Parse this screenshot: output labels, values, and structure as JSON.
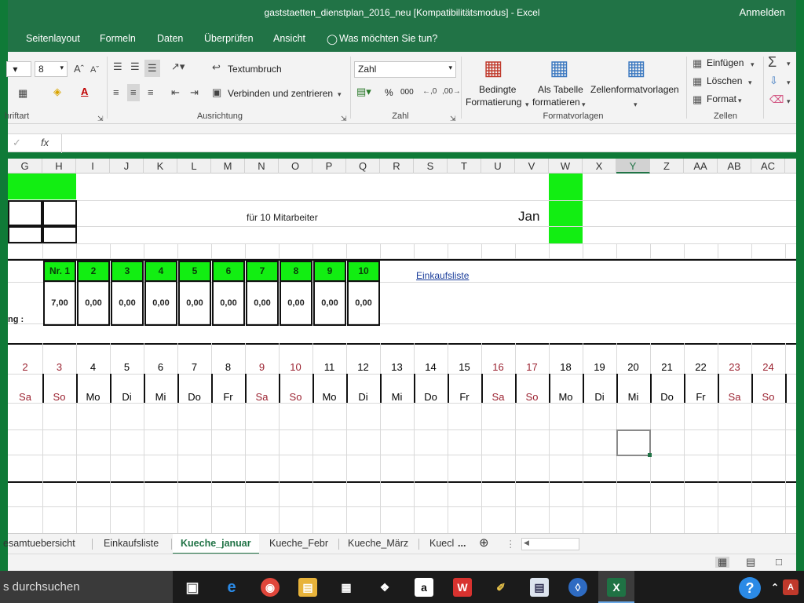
{
  "window": {
    "title": "gaststaetten_dienstplan_2016_neu  [Kompatibilitätsmodus] - Excel",
    "signin": "Anmelden"
  },
  "menu": [
    "Seitenlayout",
    "Formeln",
    "Daten",
    "Überprüfen",
    "Ansicht",
    "Was möchten Sie tun?"
  ],
  "ribbon": {
    "font_size": "8",
    "group_font": "hriftart",
    "wrap_text": "Textumbruch",
    "merge_center": "Verbinden und zentrieren",
    "group_alignment": "Ausrichtung",
    "number_format": "Zahl",
    "percent": "%",
    "thousands": "000",
    "group_number": "Zahl",
    "cond_format_1": "Bedingte",
    "cond_format_2": "Formatierung",
    "as_table_1": "Als Tabelle",
    "as_table_2": "formatieren",
    "cell_styles": "Zellenformatvorlagen",
    "group_styles": "Formatvorlagen",
    "insert": "Einfügen",
    "delete": "Löschen",
    "format": "Format",
    "group_cells": "Zellen"
  },
  "formula_bar": {
    "fx": "fx",
    "value": ""
  },
  "columns": [
    "G",
    "H",
    "I",
    "J",
    "K",
    "L",
    "M",
    "N",
    "O",
    "P",
    "Q",
    "R",
    "S",
    "T",
    "U",
    "V",
    "W",
    "X",
    "Y",
    "Z",
    "AA",
    "AB",
    "AC"
  ],
  "selected_column": "Y",
  "sheet": {
    "subtitle": "für 10 Mitarbeiter",
    "month": "Jan",
    "shopping_link": "Einkaufsliste",
    "row_label": "ng :",
    "employee_headers": [
      "Nr. 1",
      "2",
      "3",
      "4",
      "5",
      "6",
      "7",
      "8",
      "9",
      "10"
    ],
    "employee_values": [
      "7,00",
      "0,00",
      "0,00",
      "0,00",
      "0,00",
      "0,00",
      "0,00",
      "0,00",
      "0,00",
      "0,00"
    ],
    "days": [
      "2",
      "3",
      "4",
      "5",
      "6",
      "7",
      "8",
      "9",
      "10",
      "11",
      "12",
      "13",
      "14",
      "15",
      "16",
      "17",
      "18",
      "19",
      "20",
      "21",
      "22",
      "23",
      "24"
    ],
    "weekdays": [
      "Sa",
      "So",
      "Mo",
      "Di",
      "Mi",
      "Do",
      "Fr",
      "Sa",
      "So",
      "Mo",
      "Di",
      "Mi",
      "Do",
      "Fr",
      "Sa",
      "So",
      "Mo",
      "Di",
      "Mi",
      "Do",
      "Fr",
      "Sa",
      "So"
    ],
    "weekend_color": "#9b2230",
    "highlight_color": "#12ee12"
  },
  "tabs": [
    "esamtuebersicht",
    "Einkaufsliste",
    "Kueche_januar",
    "Kueche_Febr",
    "Kueche_März",
    "Kuecl",
    "..."
  ],
  "active_tab": "Kueche_januar",
  "taskbar": {
    "search": "s durchsuchen"
  }
}
